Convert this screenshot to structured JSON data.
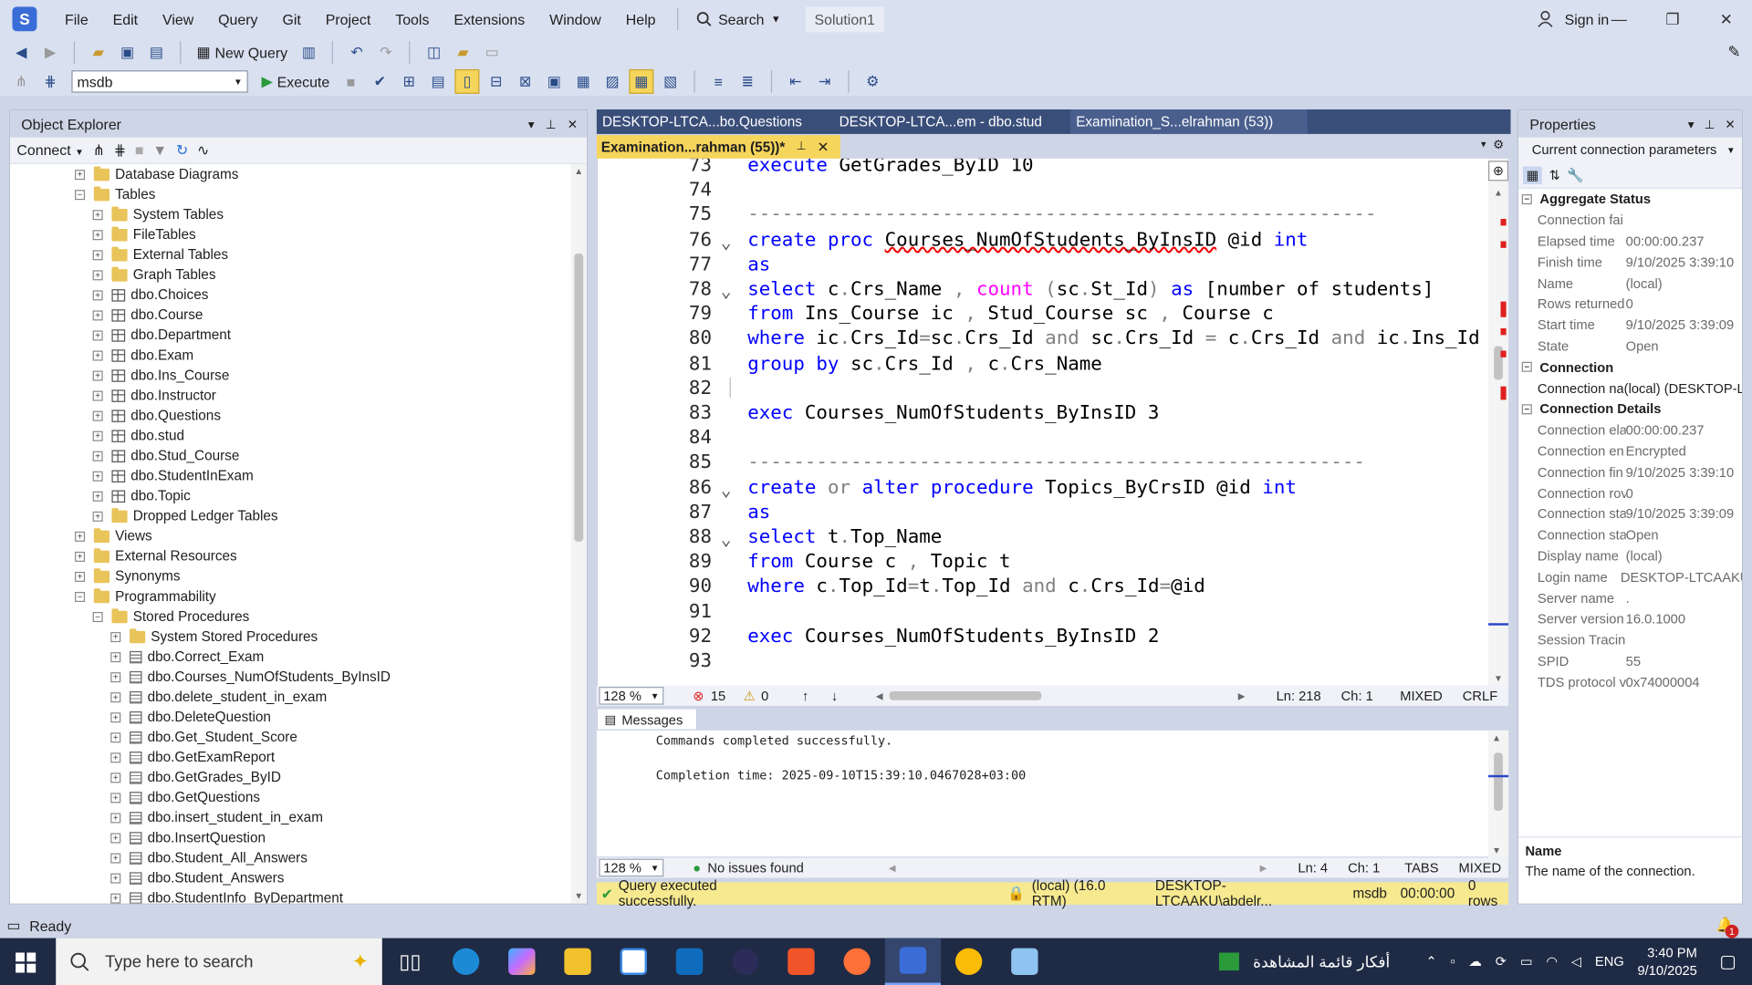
{
  "menubar": {
    "items": [
      "File",
      "Edit",
      "View",
      "Query",
      "Git",
      "Project",
      "Tools",
      "Extensions",
      "Window",
      "Help"
    ],
    "search_label": "Search",
    "solution": "Solution1",
    "signin": "Sign in"
  },
  "toolbar": {
    "new_query": "New Query",
    "database": "msdb",
    "execute": "Execute"
  },
  "object_explorer": {
    "title": "Object Explorer",
    "connect": "Connect",
    "tree": [
      {
        "label": "Database Diagrams",
        "level": 0,
        "icon": "folder",
        "exp": "+"
      },
      {
        "label": "Tables",
        "level": 0,
        "icon": "folder",
        "exp": "-"
      },
      {
        "label": "System Tables",
        "level": 1,
        "icon": "folder",
        "exp": "+"
      },
      {
        "label": "FileTables",
        "level": 1,
        "icon": "folder",
        "exp": "+"
      },
      {
        "label": "External Tables",
        "level": 1,
        "icon": "folder",
        "exp": "+"
      },
      {
        "label": "Graph Tables",
        "level": 1,
        "icon": "folder",
        "exp": "+"
      },
      {
        "label": "dbo.Choices",
        "level": 1,
        "icon": "table",
        "exp": "+"
      },
      {
        "label": "dbo.Course",
        "level": 1,
        "icon": "table",
        "exp": "+"
      },
      {
        "label": "dbo.Department",
        "level": 1,
        "icon": "table",
        "exp": "+"
      },
      {
        "label": "dbo.Exam",
        "level": 1,
        "icon": "table",
        "exp": "+"
      },
      {
        "label": "dbo.Ins_Course",
        "level": 1,
        "icon": "table",
        "exp": "+"
      },
      {
        "label": "dbo.Instructor",
        "level": 1,
        "icon": "table",
        "exp": "+"
      },
      {
        "label": "dbo.Questions",
        "level": 1,
        "icon": "table",
        "exp": "+"
      },
      {
        "label": "dbo.stud",
        "level": 1,
        "icon": "table",
        "exp": "+"
      },
      {
        "label": "dbo.Stud_Course",
        "level": 1,
        "icon": "table",
        "exp": "+"
      },
      {
        "label": "dbo.StudentInExam",
        "level": 1,
        "icon": "table",
        "exp": "+"
      },
      {
        "label": "dbo.Topic",
        "level": 1,
        "icon": "table",
        "exp": "+"
      },
      {
        "label": "Dropped Ledger Tables",
        "level": 1,
        "icon": "folder",
        "exp": "+"
      },
      {
        "label": "Views",
        "level": 0,
        "icon": "folder",
        "exp": "+"
      },
      {
        "label": "External Resources",
        "level": 0,
        "icon": "folder",
        "exp": "+"
      },
      {
        "label": "Synonyms",
        "level": 0,
        "icon": "folder",
        "exp": "+"
      },
      {
        "label": "Programmability",
        "level": 0,
        "icon": "folder",
        "exp": "-"
      },
      {
        "label": "Stored Procedures",
        "level": 1,
        "icon": "folder",
        "exp": "-"
      },
      {
        "label": "System Stored Procedures",
        "level": 2,
        "icon": "folder",
        "exp": "+"
      },
      {
        "label": "dbo.Correct_Exam",
        "level": 2,
        "icon": "proc",
        "exp": "+"
      },
      {
        "label": "dbo.Courses_NumOfStudents_ByInsID",
        "level": 2,
        "icon": "proc",
        "exp": "+"
      },
      {
        "label": "dbo.delete_student_in_exam",
        "level": 2,
        "icon": "proc",
        "exp": "+"
      },
      {
        "label": "dbo.DeleteQuestion",
        "level": 2,
        "icon": "proc",
        "exp": "+"
      },
      {
        "label": "dbo.Get_Student_Score",
        "level": 2,
        "icon": "proc",
        "exp": "+"
      },
      {
        "label": "dbo.GetExamReport",
        "level": 2,
        "icon": "proc",
        "exp": "+"
      },
      {
        "label": "dbo.GetGrades_ByID",
        "level": 2,
        "icon": "proc",
        "exp": "+"
      },
      {
        "label": "dbo.GetQuestions",
        "level": 2,
        "icon": "proc",
        "exp": "+"
      },
      {
        "label": "dbo.insert_student_in_exam",
        "level": 2,
        "icon": "proc",
        "exp": "+"
      },
      {
        "label": "dbo.InsertQuestion",
        "level": 2,
        "icon": "proc",
        "exp": "+"
      },
      {
        "label": "dbo.Student_All_Answers",
        "level": 2,
        "icon": "proc",
        "exp": "+"
      },
      {
        "label": "dbo.Student_Answers",
        "level": 2,
        "icon": "proc",
        "exp": "+"
      },
      {
        "label": "dbo.StudentInfo_ByDepartment",
        "level": 2,
        "icon": "proc",
        "exp": "+"
      }
    ]
  },
  "tabs": {
    "inactive": [
      "DESKTOP-LTCA...bo.Questions",
      "DESKTOP-LTCA...em - dbo.stud",
      "Examination_S...elrahman (53))"
    ],
    "active": "Examination...rahman (55))*"
  },
  "editor": {
    "lines": [
      {
        "n": "73",
        "fold": "",
        "html": "<span class='kw'>execute</span> GetGrades_ByID 10"
      },
      {
        "n": "74",
        "fold": "",
        "html": ""
      },
      {
        "n": "75",
        "fold": "",
        "html": "<span class='gr'>-------------------------------------------------------</span>"
      },
      {
        "n": "76",
        "fold": "v",
        "html": "<span class='kw'>create</span> <span class='kw'>proc</span> <span class='squig'>Courses_NumOfStudents_ByInsID</span> @id <span class='kw'>int</span>"
      },
      {
        "n": "77",
        "fold": "",
        "html": "<span class='kw'>as</span>"
      },
      {
        "n": "78",
        "fold": "v",
        "html": "<span class='kw'>select</span> c<span class='gr'>.</span>Crs_Name <span class='gr'>,</span> <span class='fn'>count</span> <span class='gr'>(</span>sc<span class='gr'>.</span>St_Id<span class='gr'>)</span> <span class='kw'>as</span> [number of students]"
      },
      {
        "n": "79",
        "fold": "",
        "html": "<span class='kw'>from</span> Ins_Course ic <span class='gr'>,</span> Stud_Course sc <span class='gr'>,</span> Course c"
      },
      {
        "n": "80",
        "fold": "",
        "html": "<span class='kw'>where</span> ic<span class='gr'>.</span>Crs_Id<span class='gr'>=</span>sc<span class='gr'>.</span>Crs_Id <span class='gr'>and</span> sc<span class='gr'>.</span>Crs_Id <span class='gr'>=</span> c<span class='gr'>.</span>Crs_Id <span class='gr'>and</span> ic<span class='gr'>.</span>Ins_Id <span class='gr'>=</span>"
      },
      {
        "n": "81",
        "fold": "",
        "html": "<span class='kw'>group by</span> sc<span class='gr'>.</span>Crs_Id <span class='gr'>,</span> c<span class='gr'>.</span>Crs_Name"
      },
      {
        "n": "82",
        "fold": "",
        "html": ""
      },
      {
        "n": "83",
        "fold": "",
        "html": "<span class='kw'>exec</span> Courses_NumOfStudents_ByInsID 3"
      },
      {
        "n": "84",
        "fold": "",
        "html": ""
      },
      {
        "n": "85",
        "fold": "",
        "html": "<span class='gr'>------------------------------------------------------</span>"
      },
      {
        "n": "86",
        "fold": "v",
        "html": "<span class='kw'>create</span> <span class='gr'>or</span> <span class='kw'>alter</span> <span class='kw'>procedure</span> Topics_ByCrsID @id <span class='kw'>int</span>"
      },
      {
        "n": "87",
        "fold": "",
        "html": "<span class='kw'>as</span>"
      },
      {
        "n": "88",
        "fold": "v",
        "html": "<span class='kw'>select</span> t<span class='gr'>.</span>Top_Name"
      },
      {
        "n": "89",
        "fold": "",
        "html": "<span class='kw'>from</span> Course c <span class='gr'>,</span> Topic t"
      },
      {
        "n": "90",
        "fold": "",
        "html": "<span class='kw'>where</span> c<span class='gr'>.</span>Top_Id<span class='gr'>=</span>t<span class='gr'>.</span>Top_Id <span class='gr'>and</span> c<span class='gr'>.</span>Crs_Id<span class='gr'>=</span>@id"
      },
      {
        "n": "91",
        "fold": "",
        "html": ""
      },
      {
        "n": "92",
        "fold": "",
        "html": "<span class='kw'>exec</span> Courses_NumOfStudents_ByInsID 2"
      },
      {
        "n": "93",
        "fold": "",
        "html": ""
      }
    ],
    "status": {
      "zoom": "128 %",
      "errors": "15",
      "warnings": "0",
      "ln": "Ln: 218",
      "ch": "Ch: 1",
      "mixed": "MIXED",
      "crlf": "CRLF"
    }
  },
  "messages": {
    "tab": "Messages",
    "line1": "Commands completed successfully.",
    "line2": "Completion time: 2025-09-10T15:39:10.0467028+03:00",
    "status": {
      "zoom": "128 %",
      "issues": "No issues found",
      "ln": "Ln: 4",
      "ch": "Ch: 1",
      "tabs": "TABS",
      "mixed": "MIXED"
    }
  },
  "query_status": {
    "text": "Query executed successfully.",
    "server": "(local) (16.0 RTM)",
    "user": "DESKTOP-LTCAAKU\\abdelr...",
    "db": "msdb",
    "time": "00:00:00",
    "rows": "0 rows"
  },
  "properties": {
    "title": "Properties",
    "selector": "Current connection parameters",
    "sections": [
      {
        "name": "Aggregate Status",
        "rows": [
          [
            "Connection fai",
            ""
          ],
          [
            "Elapsed time",
            "00:00:00.237"
          ],
          [
            "Finish time",
            "9/10/2025 3:39:10"
          ],
          [
            "Name",
            "(local)"
          ],
          [
            "Rows returned",
            "0"
          ],
          [
            "Start time",
            "9/10/2025 3:39:09"
          ],
          [
            "State",
            "Open"
          ]
        ]
      },
      {
        "name": "Connection",
        "rows": [
          [
            "Connection na",
            "(local) (DESKTOP-L"
          ]
        ]
      },
      {
        "name": "Connection Details",
        "rows": [
          [
            "Connection ela",
            "00:00:00.237"
          ],
          [
            "Connection en",
            "Encrypted"
          ],
          [
            "Connection fin",
            "9/10/2025 3:39:10"
          ],
          [
            "Connection rov",
            "0"
          ],
          [
            "Connection sta",
            "9/10/2025 3:39:09"
          ],
          [
            "Connection sta",
            "Open"
          ],
          [
            "Display name",
            "(local)"
          ],
          [
            "Login name",
            "DESKTOP-LTCAAKU"
          ],
          [
            "Server name",
            "."
          ],
          [
            "Server version",
            "16.0.1000"
          ],
          [
            "Session Tracing",
            ""
          ],
          [
            "SPID",
            "55"
          ],
          [
            "TDS protocol v",
            "0x74000004"
          ]
        ]
      }
    ],
    "desc_title": "Name",
    "desc_text": "The name of the connection."
  },
  "statusbar": {
    "text": "Ready"
  },
  "taskbar": {
    "search_placeholder": "Type here to search",
    "tray_text": "أفكار قائمة المشاهدة",
    "lang": "ENG",
    "time": "3:40 PM",
    "date": "9/10/2025",
    "notif_count": "1"
  }
}
